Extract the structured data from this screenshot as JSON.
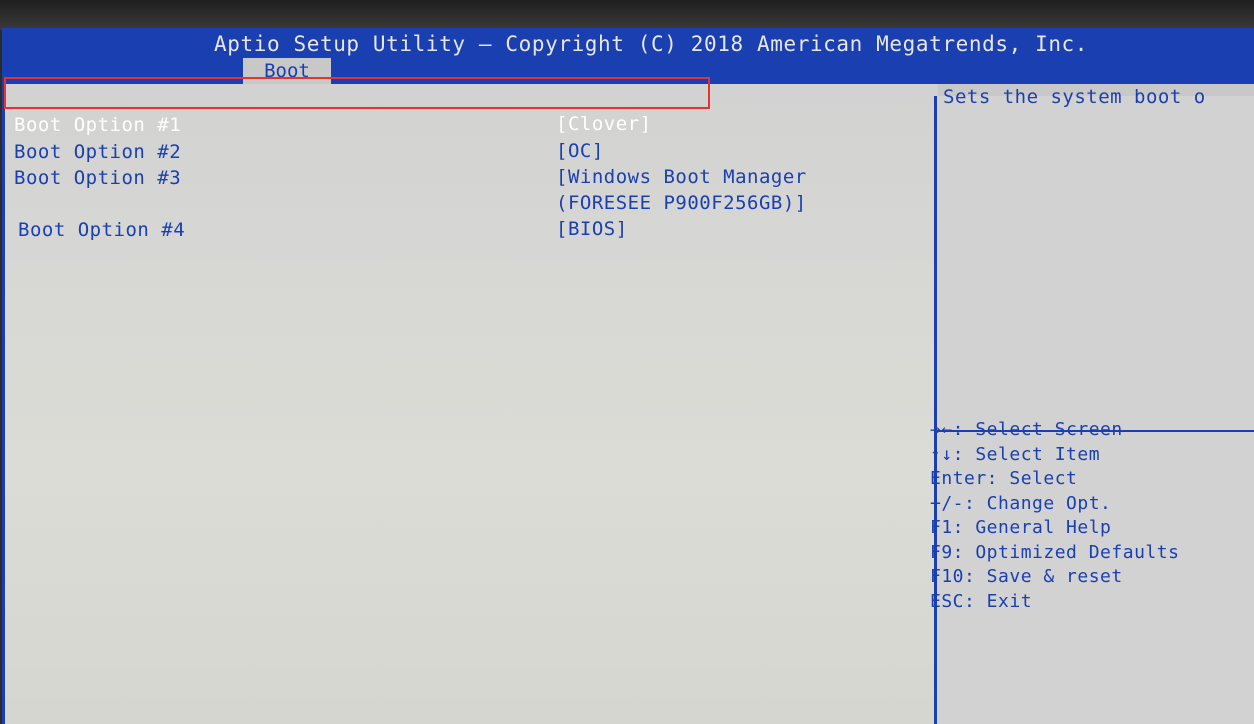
{
  "header": {
    "title": "Aptio Setup Utility – Copyright (C) 2018 American Megatrends, Inc.",
    "tabs": [
      {
        "label": "Boot",
        "active": true
      }
    ]
  },
  "boot_options": [
    {
      "label": "Boot Option #1",
      "value": "[Clover]",
      "selected": true
    },
    {
      "label": "Boot Option #2",
      "value": "[OC]",
      "selected": false
    },
    {
      "label": "Boot Option #3",
      "value": "[Windows Boot Manager",
      "value_line2": "(FORESEE P900F256GB)]",
      "selected": false
    },
    {
      "label": "Boot Option #4",
      "value": "[BIOS]",
      "selected": false
    }
  ],
  "help": {
    "description": "Sets the system boot o"
  },
  "keys": [
    "→←: Select Screen",
    "↑↓: Select Item",
    "Enter: Select",
    "+/-: Change Opt.",
    "F1: General Help",
    "F9: Optimized Defaults",
    "F10: Save & reset",
    "ESC: Exit"
  ],
  "colors": {
    "header_bg": "#1a3fb0",
    "text": "#1a3fb0",
    "panel_bg": "#c8c8c8",
    "selected_text": "#ffffff",
    "highlight_border": "#e8322e"
  }
}
